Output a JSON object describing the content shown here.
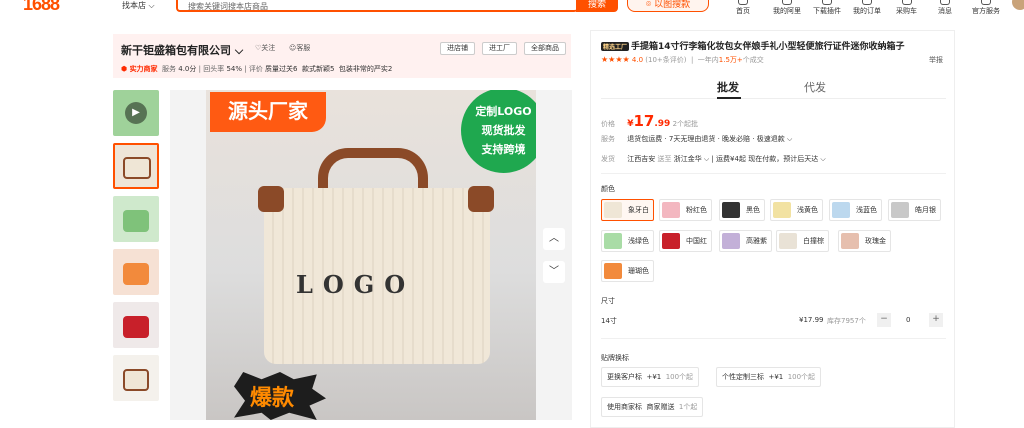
{
  "header": {
    "logo": "1688",
    "find_shop": "找本店",
    "search_placeholder": "搜索关键词搜本店商品",
    "search_btn": "搜索",
    "image_search": "以图搜款",
    "nav": [
      "首页",
      "我的阿里",
      "下载插件",
      "我的订单",
      "采购车",
      "消息",
      "官方服务"
    ]
  },
  "shop": {
    "name": "新干钜盛箱包有限公司",
    "follow": "关注",
    "favorite": "客服",
    "buttons": [
      "进店铺",
      "进工厂",
      "全部商品"
    ],
    "tag": "实力商家",
    "stats": [
      {
        "k": "服务",
        "v": "4.0分"
      },
      {
        "k": "回头率",
        "v": "54%"
      },
      {
        "k": "评价",
        "v": "质量过关6"
      },
      {
        "k": "",
        "v": "款式新颖5"
      },
      {
        "k": "",
        "v": "包装非常的严实2"
      }
    ]
  },
  "gallery": {
    "slogan": "源头厂家",
    "badge": [
      "定制LOGO",
      "现货批发",
      "支持跨境"
    ],
    "logo_text": "LOGO",
    "hot": "爆款"
  },
  "product": {
    "tag": "精选工厂",
    "title": "手提箱14寸行李箱化妆包女伴娘手礼小型轻便旅行证件迷你收纳箱子",
    "stars": "★★★★",
    "score": "4.0",
    "reviews": "(10+条评价)",
    "sold_prefix": "一年内",
    "sold": "1.5万+",
    "sold_suffix": "个成交",
    "report": "举报",
    "tabs": [
      "批发",
      "代发"
    ],
    "price_label": "价格",
    "price_symbol": "¥",
    "price_int": "17",
    "price_dec": ".99",
    "moq": "2个起批",
    "service_label": "服务",
    "service": "退货包运费 · 7天无理由退货 · 晚发必赔 · 极速退款 ⌵",
    "ship_label": "发货",
    "ship_from": "江西吉安",
    "ship_to_word": "送至",
    "ship_to": "浙江金华 ⌵",
    "ship_fee": "运费¥4起",
    "ship_time": "现在付款，预计后天达 ⌵"
  },
  "colors": {
    "label": "颜色",
    "options": [
      {
        "name": "象牙白",
        "color": "#efe6d6"
      },
      {
        "name": "粉红色",
        "color": "#f3b7c0"
      },
      {
        "name": "黑色",
        "color": "#333333"
      },
      {
        "name": "浅黄色",
        "color": "#f2e2a2"
      },
      {
        "name": "浅蓝色",
        "color": "#bcd8ee"
      },
      {
        "name": "皓月银",
        "color": "#c8c8c8"
      },
      {
        "name": "浅绿色",
        "color": "#a9dca6"
      },
      {
        "name": "中国红",
        "color": "#c8202a"
      },
      {
        "name": "高雅紫",
        "color": "#c3b0d8"
      },
      {
        "name": "白撞棕",
        "color": "#e9e2d6"
      },
      {
        "name": "玫瑰金",
        "color": "#e6bfae"
      },
      {
        "name": "珊瑚色",
        "color": "#f28a3c"
      }
    ]
  },
  "size": {
    "label": "尺寸",
    "name": "14寸",
    "price": "¥17.99",
    "stock": "库存7957个",
    "minus": "−",
    "qty": "0",
    "plus": "+"
  },
  "custom": {
    "label": "贴牌换标",
    "chips": [
      {
        "name": "更换客户标",
        "price": "+¥1",
        "moq": "100个起"
      },
      {
        "name": "个性定制三标",
        "price": "+¥1",
        "moq": "100个起"
      }
    ],
    "chip2": {
      "name": "使用商家标",
      "sub": "商家赠送",
      "moq": "1个起"
    }
  }
}
